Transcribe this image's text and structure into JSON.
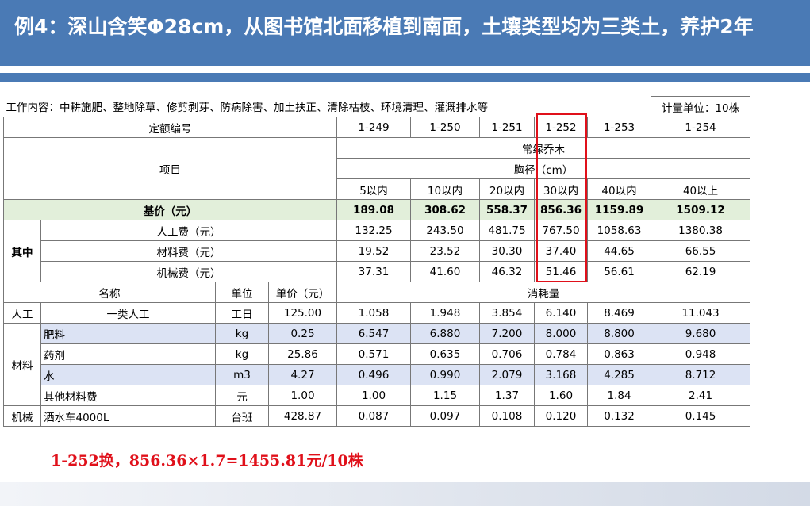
{
  "slide": {
    "title": "例4：深山含笑Φ28cm，从图书馆北面移植到南面，土壤类型均为三类土，养护2年",
    "note": "1-252换，856.36×1.7=1455.81元/10株"
  },
  "colors": {
    "title_bar": "#4a7ab5",
    "highlight_box": "#e0101a",
    "base_price_row": "#e2efda",
    "material_row": "#dce3f4"
  },
  "table": {
    "work_content": "工作内容：中耕施肥、整地除草、修剪剥芽、防病除害、加土扶正、清除枯枝、环境清理、灌溉排水等",
    "unit": "计量单位：10株",
    "code_label": "定额编号",
    "codes": [
      "1-249",
      "1-250",
      "1-251",
      "1-252",
      "1-253",
      "1-254"
    ],
    "item_label": "项目",
    "category": "常绿乔木",
    "diameter": "胸径（cm）",
    "ranges": [
      "5以内",
      "10以内",
      "20以内",
      "30以内",
      "40以内",
      "40以上"
    ],
    "base_price": {
      "label": "基价（元）",
      "values": [
        "189.08",
        "308.62",
        "558.37",
        "856.36",
        "1159.89",
        "1509.12"
      ]
    },
    "of_which": "其中",
    "labor_cost": {
      "label": "人工费（元）",
      "values": [
        "132.25",
        "243.50",
        "481.75",
        "767.50",
        "1058.63",
        "1380.38"
      ]
    },
    "material_cost": {
      "label": "材料费（元）",
      "values": [
        "19.52",
        "23.52",
        "30.30",
        "37.40",
        "44.65",
        "66.55"
      ]
    },
    "machine_cost": {
      "label": "机械费（元）",
      "values": [
        "37.31",
        "41.60",
        "46.32",
        "51.46",
        "56.61",
        "62.19"
      ]
    },
    "headers": {
      "name": "名称",
      "unit": "单位",
      "price": "单价（元）",
      "consumption": "消耗量"
    },
    "labor_group": "人工",
    "material_group": "材料",
    "machine_group": "机械",
    "rows": {
      "labor": {
        "name": "一类人工",
        "unit": "工日",
        "price": "125.00",
        "values": [
          "1.058",
          "1.948",
          "3.854",
          "6.140",
          "8.469",
          "11.043"
        ]
      },
      "fertilizer": {
        "name": "肥料",
        "unit": "kg",
        "price": "0.25",
        "values": [
          "6.547",
          "6.880",
          "7.200",
          "8.000",
          "8.800",
          "9.680"
        ]
      },
      "pesticide": {
        "name": "药剂",
        "unit": "kg",
        "price": "25.86",
        "values": [
          "0.571",
          "0.635",
          "0.706",
          "0.784",
          "0.863",
          "0.948"
        ]
      },
      "water": {
        "name": "水",
        "unit": "m3",
        "price": "4.27",
        "values": [
          "0.496",
          "0.990",
          "2.079",
          "3.168",
          "4.285",
          "8.712"
        ]
      },
      "other_material": {
        "name": "其他材料费",
        "unit": "元",
        "price": "1.00",
        "values": [
          "1.00",
          "1.15",
          "1.37",
          "1.60",
          "1.84",
          "2.41"
        ]
      },
      "sprinkler": {
        "name": "洒水车4000L",
        "unit": "台班",
        "price": "428.87",
        "values": [
          "0.087",
          "0.097",
          "0.108",
          "0.120",
          "0.132",
          "0.145"
        ]
      }
    }
  }
}
